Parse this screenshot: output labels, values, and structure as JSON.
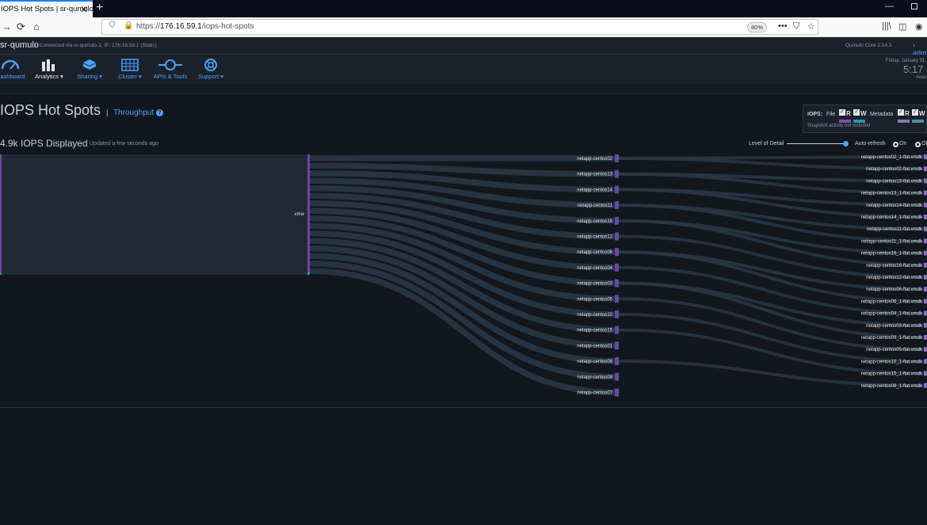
{
  "browser": {
    "tab_title": "IOPS Hot Spots | sr-qumulo",
    "tab_close": "✕",
    "new_tab": "+",
    "url_prefix": "https://",
    "url_host": "176.16.59.1",
    "url_path": "/iops-hot-spots",
    "zoom": "80%",
    "page_actions": "•••"
  },
  "app": {
    "cluster": "sr-qumulo",
    "connection": "Connected via sr-qumulo-1, IP: 176.16.59.1 (Static)",
    "version": "Qumulo Core 2.14.3",
    "user": "adm",
    "date": "Friday, January 31,",
    "time": "5:17 P",
    "timezone": "Asia/"
  },
  "nav": [
    {
      "label": "ashboard",
      "icon": "dashboard-icon"
    },
    {
      "label": "Analytics ▾",
      "icon": "analytics-icon"
    },
    {
      "label": "Sharing ▾",
      "icon": "sharing-icon"
    },
    {
      "label": "Cluster ▾",
      "icon": "cluster-icon"
    },
    {
      "label": "APIs & Tools",
      "icon": "api-icon"
    },
    {
      "label": "Support ▾",
      "icon": "support-icon"
    }
  ],
  "page": {
    "title": "IOPS Hot Spots",
    "separator": "|",
    "throughput_link": "Throughput",
    "help": "?",
    "iops_count": "4.9k IOPS Displayed",
    "updated": "Updated a few seconds ago",
    "level_of_detail_label": "Level of Detail",
    "level_of_detail": 0.96,
    "auto_refresh_label": "Auto-refresh",
    "on_label": "On",
    "off_label": "Of",
    "auto_refresh_selected": "On"
  },
  "legend": {
    "iops_label": "IOPS:",
    "file_label": "File",
    "metadata_label": "Metadata",
    "r": "R",
    "w": "W",
    "check": "✓",
    "note": "Snapshot activity not included",
    "colors": {
      "file_r": "#7b4fb5",
      "file_w": "#1e9bb0",
      "meta_r": "#8d72b5",
      "meta_w": "#4c8f99"
    }
  },
  "sankey": {
    "root_label": "vmw",
    "colors": {
      "read": "#6b46a8",
      "write": "#17a2a4",
      "flow": "#2a3847",
      "block": "#1f2a35"
    },
    "hosts": [
      "netapp-centos02",
      "netapp-centos13",
      "netapp-centos14",
      "netapp-centos11",
      "netapp-centos16",
      "netapp-centos12",
      "netapp-centos06",
      "netapp-centos04",
      "netapp-centos03",
      "netapp-centos05",
      "netapp-centos10",
      "netapp-centos15",
      "netapp-centos01",
      "netapp-centos08",
      "netapp-centos09",
      "netapp-centos07"
    ],
    "files": [
      "netapp-centos02_1-flat.vmdk",
      "netapp-centos02-flat.vmdk",
      "netapp-centos13-flat.vmdk",
      "netapp-centos13_1-flat.vmdk",
      "netapp-centos14-flat.vmdk",
      "netapp-centos14_1-flat.vmdk",
      "netapp-centos11-flat.vmdk",
      "netapp-centos11_1-flat.vmdk",
      "netapp-centos16_1-flat.vmdk",
      "netapp-centos16-flat.vmdk",
      "netapp-centos12-flat.vmdk",
      "netapp-centos06-flat.vmdk",
      "netapp-centos06_1-flat.vmdk",
      "netapp-centos04_1-flat.vmdk",
      "netapp-centos03-flat.vmdk",
      "netapp-centos03_1-flat.vmdk",
      "netapp-centos05-flat.vmdk",
      "netapp-centos10_1-flat.vmdk",
      "netapp-centos15_1-flat.vmdk",
      "netapp-centos08_1-flat.vmdk"
    ],
    "links": [
      [
        0,
        0
      ],
      [
        0,
        1
      ],
      [
        1,
        2
      ],
      [
        1,
        3
      ],
      [
        2,
        4
      ],
      [
        2,
        5
      ],
      [
        3,
        6
      ],
      [
        3,
        7
      ],
      [
        4,
        8
      ],
      [
        4,
        9
      ],
      [
        5,
        10
      ],
      [
        6,
        11
      ],
      [
        6,
        12
      ],
      [
        7,
        13
      ],
      [
        8,
        14
      ],
      [
        8,
        15
      ],
      [
        9,
        16
      ],
      [
        10,
        17
      ],
      [
        11,
        18
      ],
      [
        13,
        19
      ]
    ]
  }
}
